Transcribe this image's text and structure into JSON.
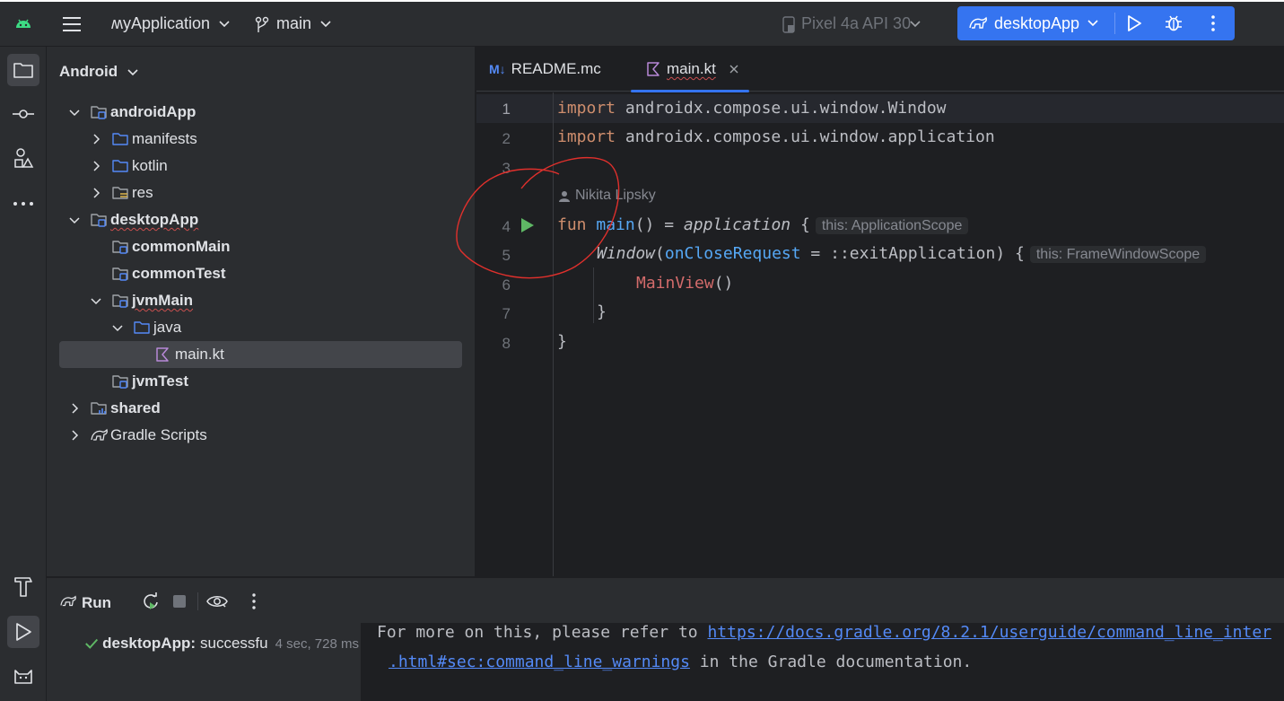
{
  "toolbar": {
    "project_name": "ʍyApplication",
    "branch": "main",
    "device": "Pixel 4a API 30",
    "run_config": "desktopApp"
  },
  "project_panel": {
    "title": "Android",
    "tree": [
      {
        "label": "androidApp",
        "bold": true,
        "wavy": false,
        "expanded": true,
        "depth": 0,
        "icon": "module-folder-icon"
      },
      {
        "label": "manifests",
        "bold": false,
        "wavy": false,
        "expanded": false,
        "depth": 1,
        "icon": "folder-icon"
      },
      {
        "label": "kotlin",
        "bold": false,
        "wavy": false,
        "expanded": false,
        "depth": 1,
        "icon": "folder-icon"
      },
      {
        "label": "res",
        "bold": false,
        "wavy": false,
        "expanded": false,
        "depth": 1,
        "icon": "resources-folder-icon"
      },
      {
        "label": "desktopApp",
        "bold": true,
        "wavy": true,
        "expanded": true,
        "depth": 0,
        "icon": "module-folder-icon"
      },
      {
        "label": "commonMain",
        "bold": true,
        "wavy": false,
        "expanded": null,
        "depth": 1,
        "icon": "module-folder-icon"
      },
      {
        "label": "commonTest",
        "bold": true,
        "wavy": false,
        "expanded": null,
        "depth": 1,
        "icon": "module-folder-icon"
      },
      {
        "label": "jvmMain",
        "bold": true,
        "wavy": true,
        "expanded": true,
        "depth": 1,
        "icon": "module-folder-icon"
      },
      {
        "label": "java",
        "bold": false,
        "wavy": false,
        "expanded": true,
        "depth": 2,
        "icon": "folder-icon"
      },
      {
        "label": "main.kt",
        "bold": false,
        "wavy": false,
        "expanded": null,
        "depth": 3,
        "icon": "kotlin-file-icon",
        "selected": true
      },
      {
        "label": "jvmTest",
        "bold": true,
        "wavy": false,
        "expanded": null,
        "depth": 1,
        "icon": "module-folder-icon"
      },
      {
        "label": "shared",
        "bold": true,
        "wavy": false,
        "expanded": false,
        "depth": 0,
        "icon": "shared-module-icon"
      },
      {
        "label": "Gradle Scripts",
        "bold": false,
        "wavy": false,
        "expanded": false,
        "depth": 0,
        "icon": "gradle-icon"
      }
    ]
  },
  "editor": {
    "tabs": [
      {
        "label": "README.mc",
        "badge": "M↓",
        "active": false
      },
      {
        "label": "main.kt",
        "active": true
      }
    ],
    "line_numbers": [
      "1",
      "2",
      "3",
      "4",
      "5",
      "6",
      "7",
      "8"
    ],
    "author_hint": "Nikita Lipsky",
    "code": {
      "l1_kw": "import",
      "l1_rest": " androidx.compose.ui.window.Window",
      "l2_kw": "import",
      "l2_rest": " androidx.compose.ui.window.application",
      "l4_kw": "fun",
      "l4_fn": "main",
      "l4_mid": "() = ",
      "l4_call": "application",
      "l4_brace": " {",
      "l4_hint": "this: ApplicationScope",
      "l5_call": "Window",
      "l5_open": "(",
      "l5_param": "onCloseRequest",
      "l5_eq": " = ",
      "l5_rest": "::exitApplication) {",
      "l5_hint": "this: FrameWindowScope",
      "l6_call": "MainView",
      "l6_rest": "()",
      "l7": "}",
      "l8": "}"
    }
  },
  "run_panel": {
    "title": "Run",
    "run_item_label": "desktopApp:",
    "run_item_status": "successfu",
    "run_item_time": "4 sec, 728 ms",
    "console_l1_text": "For more on this, please refer to ",
    "console_l1_link": "https://docs.gradle.org/8.2.1/userguide/command_line_inter",
    "console_l2_link": ".html#sec:command_line_warnings",
    "console_l2_text": " in the Gradle documentation."
  },
  "colors": {
    "accent": "#3574f0",
    "run_green": "#5fb865",
    "annotation_red": "#e0302c"
  }
}
